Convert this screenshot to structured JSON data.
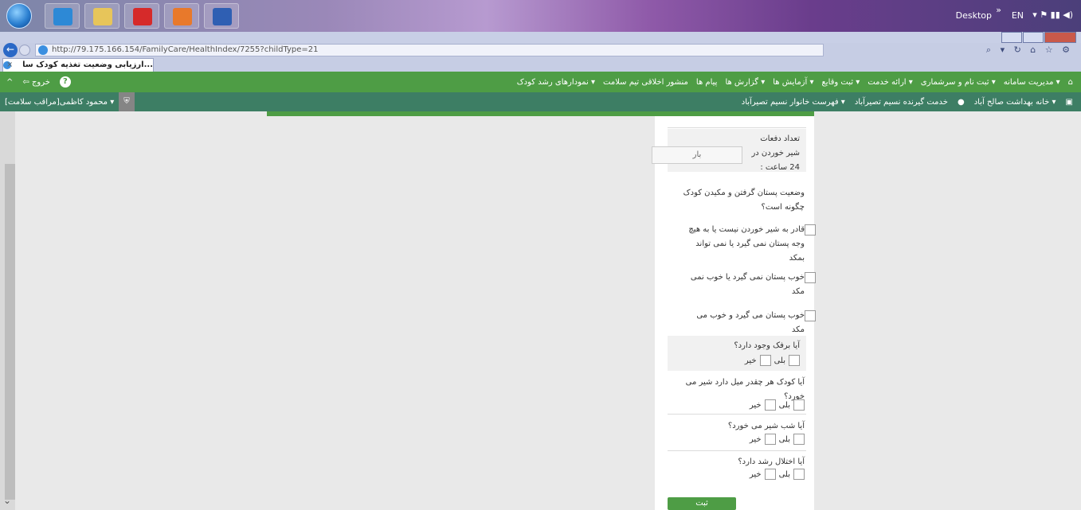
{
  "taskbar": {
    "desktop_label": "Desktop",
    "chevron": "»",
    "lang": "EN",
    "apps": [
      "ie-icon",
      "explorer-icon",
      "acrobat-icon",
      "media-icon",
      "word-icon"
    ]
  },
  "browser": {
    "url": "http://79.175.166.154/FamilyCare/HealthIndex/7255?childType=21",
    "tab_title": "...ارزیابی وضعیت تغذیه کودک سا",
    "tab_close": "×"
  },
  "nav": {
    "menu": [
      "مدیریت سامانه ▾",
      "ثبت نام و سرشماری ▾",
      "ارائه خدمت ▾",
      "ثبت وقایع ▾",
      "آزمایش ها ▾",
      "گزارش ها ▾",
      "پیام ها",
      "منشور اخلاقی تیم سلامت",
      "نمودارهای رشد کودک ▾"
    ],
    "exit": "خروج",
    "help": "?"
  },
  "subnav": {
    "crumbs": [
      "خانه بهداشت صالح آباد ▾",
      "خدمت گیرنده نسیم تصیرآباد",
      "فهرست خانوار نسیم تصیرآباد ▾"
    ],
    "user": "محمود کاظمی[مراقب سلامت] ▾"
  },
  "form": {
    "feed_count_label": "تعداد دفعات شیر خوردن در 24 ساعت :",
    "feed_count_placeholder": "بار",
    "latch_question": "وضعیت پستان گرفتن و مکیدن کودک چگونه است؟",
    "latch_opt1": "قادر به شیر خوردن نیست یا به هیچ وجه پستان نمی گیرد یا نمی تواند بمکد",
    "latch_opt2": "خوب پستان نمی گیرد یا خوب نمی مکد",
    "latch_opt3": "خوب پستان می گیرد و خوب می مکد",
    "thrush_question": "آیا برفک وجود دارد؟",
    "wants_question": "آیا کودک هر چقدر میل دارد شیر می خورد؟",
    "night_question": "آیا شب شیر می خورد؟",
    "growth_question": "آیا اختلال رشد دارد؟",
    "yes": "بلی",
    "no": "خیر",
    "submit": "ثبت"
  }
}
